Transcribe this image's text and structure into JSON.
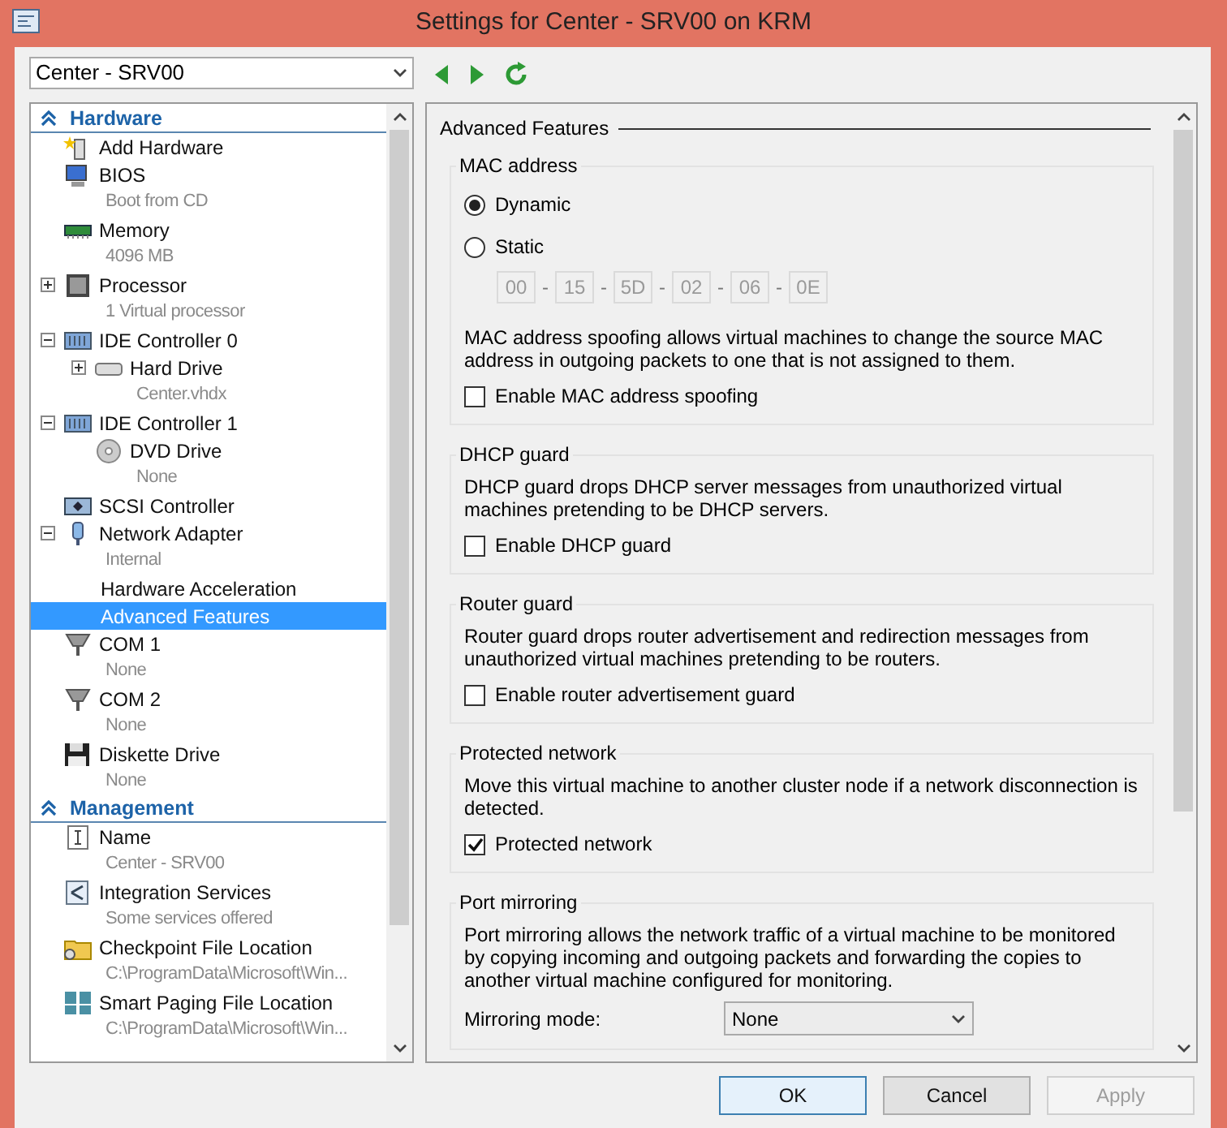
{
  "window": {
    "title": "Settings for Center - SRV00 on KRM"
  },
  "vm_selector": {
    "value": "Center - SRV00"
  },
  "tree": [
    {
      "title": "Hardware",
      "expanded": true,
      "items": [
        {
          "kind": "add",
          "label": "Add Hardware",
          "selected": false
        },
        {
          "kind": "bios",
          "label": "BIOS",
          "detail": "Boot from CD",
          "selected": false
        },
        {
          "kind": "memory",
          "label": "Memory",
          "detail": "4096 MB",
          "selected": false
        },
        {
          "kind": "processor",
          "label": "Processor",
          "detail": "1 Virtual processor",
          "expanded": false,
          "selected": false
        },
        {
          "kind": "controller",
          "label": "IDE Controller 0",
          "expanded": true,
          "selected": false,
          "children": [
            {
              "kind": "disk",
              "label": "Hard Drive",
              "detail": "Center.vhdx",
              "expanded": false,
              "selected": false
            }
          ]
        },
        {
          "kind": "controller",
          "label": "IDE Controller 1",
          "expanded": true,
          "selected": false,
          "children": [
            {
              "kind": "dvd",
              "label": "DVD Drive",
              "detail": "None",
              "selected": false
            }
          ]
        },
        {
          "kind": "scsi",
          "label": "SCSI Controller",
          "selected": false
        },
        {
          "kind": "network",
          "label": "Network Adapter",
          "detail": "Internal",
          "expanded": true,
          "selected": false,
          "children": [
            {
              "kind": "plain",
              "label": "Hardware Acceleration",
              "selected": false
            },
            {
              "kind": "plain",
              "label": "Advanced Features",
              "selected": true
            }
          ]
        },
        {
          "kind": "port",
          "label": "COM 1",
          "detail": "None",
          "selected": false
        },
        {
          "kind": "port",
          "label": "COM 2",
          "detail": "None",
          "selected": false
        },
        {
          "kind": "floppy",
          "label": "Diskette Drive",
          "detail": "None",
          "selected": false
        }
      ]
    },
    {
      "title": "Management",
      "expanded": true,
      "items": [
        {
          "kind": "name",
          "label": "Name",
          "detail": "Center - SRV00",
          "selected": false
        },
        {
          "kind": "integration",
          "label": "Integration Services",
          "detail": "Some services offered",
          "selected": false
        },
        {
          "kind": "folder",
          "label": "Checkpoint File Location",
          "detail": "C:\\ProgramData\\Microsoft\\Win...",
          "selected": false
        },
        {
          "kind": "paging",
          "label": "Smart Paging File Location",
          "detail": "C:\\ProgramData\\Microsoft\\Win...",
          "selected": false
        }
      ]
    }
  ],
  "panel": {
    "title": "Advanced Features",
    "groups": [
      {
        "title": "MAC address",
        "radios": [
          {
            "label": "Dynamic",
            "selected": true
          },
          {
            "label": "Static",
            "selected": false
          }
        ],
        "mac_fields": {
          "disabled": true,
          "separator": "-",
          "values": [
            "00",
            "15",
            "5D",
            "02",
            "06",
            "0E"
          ]
        },
        "description": "MAC address spoofing allows virtual machines to change the source MAC address in outgoing packets to one that is not assigned to them.",
        "checkbox": {
          "label": "Enable MAC address spoofing",
          "checked": false
        }
      },
      {
        "title": "DHCP guard",
        "description": "DHCP guard drops DHCP server messages from unauthorized virtual machines pretending to be DHCP servers.",
        "checkbox": {
          "label": "Enable DHCP guard",
          "checked": false
        }
      },
      {
        "title": "Router guard",
        "description": "Router guard drops router advertisement and redirection messages from unauthorized virtual machines pretending to be routers.",
        "checkbox": {
          "label": "Enable router advertisement guard",
          "checked": false
        }
      },
      {
        "title": "Protected network",
        "description": "Move this virtual machine to another cluster node if a network disconnection is detected.",
        "checkbox": {
          "label": "Protected network",
          "checked": true
        }
      },
      {
        "title": "Port mirroring",
        "description": "Port mirroring allows the network traffic of a virtual machine to be monitored by copying incoming and outgoing packets and forwarding the copies to another virtual machine configured for monitoring.",
        "select": {
          "label": "Mirroring mode:",
          "value": "None"
        }
      }
    ]
  },
  "buttons": [
    {
      "label": "OK",
      "default": true,
      "disabled": false
    },
    {
      "label": "Cancel",
      "default": false,
      "disabled": false
    },
    {
      "label": "Apply",
      "default": false,
      "disabled": true
    }
  ]
}
